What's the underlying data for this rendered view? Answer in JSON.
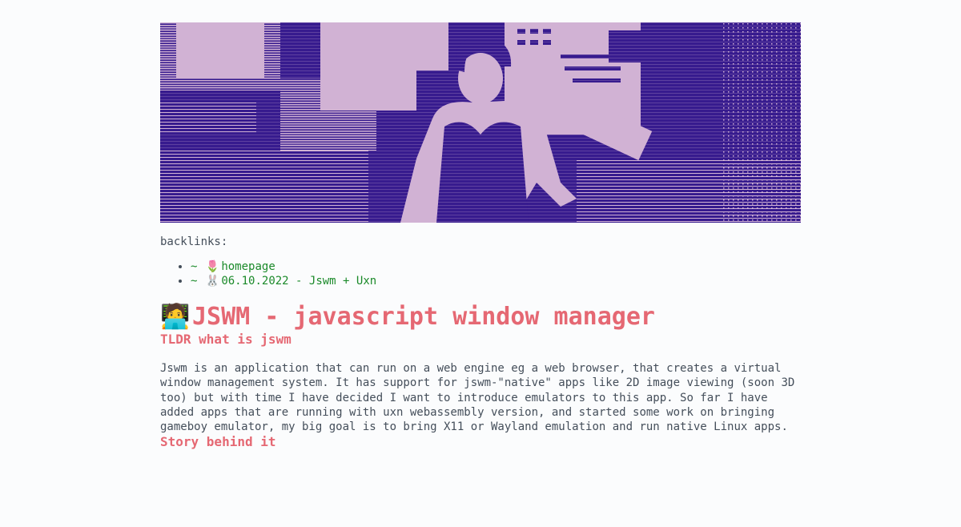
{
  "hero": {
    "image_alt": "retro dithered photo of a person at a computer console",
    "colors": {
      "bg": "#371b8e",
      "fg": "#d1b2d4"
    }
  },
  "backlinks": {
    "label": "backlinks:",
    "items": [
      {
        "prefix": "~",
        "icon": "tulip-icon",
        "glyph": "🌷",
        "label": "homepage"
      },
      {
        "prefix": "~",
        "icon": "rabbit-icon",
        "glyph": "🐰",
        "label": "06.10.2022 - Jswm + Uxn"
      }
    ]
  },
  "article": {
    "title_icon": "technologist-icon",
    "title_glyph": "🧑‍💻",
    "title": "JSWM - javascript window manager",
    "section1_heading": "TLDR what is jswm",
    "section1_body": "Jswm is an application that can run on a web engine eg a web browser, that creates a virtual\nwindow management system. It has support for jswm-\"native\" apps like 2D image viewing (soon 3D\ntoo) but with time I have decided I want to introduce emulators to this app. So far I have\nadded apps that are running with uxn webassembly version, and started some work on bringing\ngameboy emulator, my big goal is to bring X11 or Wayland emulation and run native Linux apps.",
    "section2_heading": "Story behind it"
  },
  "colors": {
    "accent": "#e56873",
    "link": "#1b8a2a",
    "text": "#444e5a",
    "background": "#fbfcfd"
  }
}
